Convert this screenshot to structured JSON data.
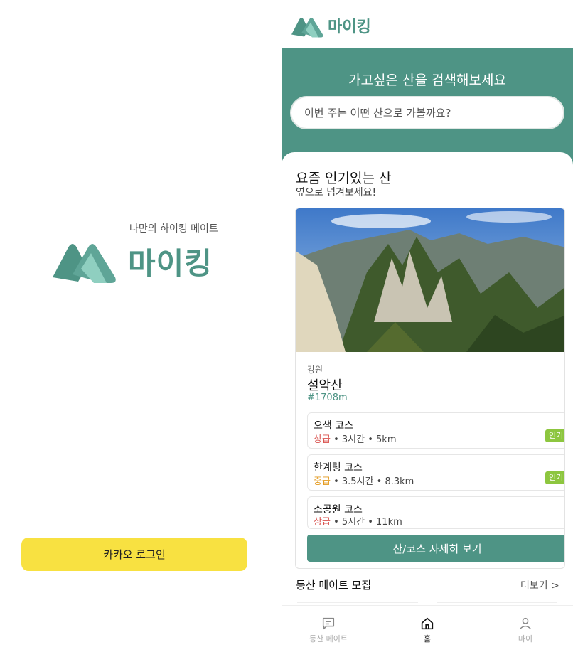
{
  "login": {
    "tagline": "나만의 하이킹 메이트",
    "app_name": "마이킹",
    "kakao_button": "카카오 로그인",
    "kakao_color": "#f8e141"
  },
  "home": {
    "app_name": "마이킹",
    "hero_title": "가고싶은 산을 검색해보세요",
    "search_placeholder": "이번 주는 어떤 산으로 가볼까요?",
    "popular_title": "요즘 인기있는 산",
    "popular_sub": "옆으로 넘겨보세요!",
    "mountain": {
      "region": "강원",
      "name": "설악산",
      "height": "#1708m",
      "courses": [
        {
          "name": "오색 코스",
          "level": "상급",
          "sep1": "•",
          "time": "3시간",
          "sep2": "•",
          "distance": "5km",
          "badge": "인기"
        },
        {
          "name": "한계령 코스",
          "level": "중급",
          "sep1": "•",
          "time": "3.5시간",
          "sep2": "•",
          "distance": "8.3km",
          "badge": "인기"
        },
        {
          "name": "소공원 코스",
          "level": "상급",
          "sep1": "•",
          "time": "5시간",
          "sep2": "•",
          "distance": "11km"
        }
      ]
    },
    "detail_button": "산/코스 자세히 보기",
    "mate_title": "등산 메이트 모집",
    "more_link": "더보기 >",
    "nav": [
      {
        "label": "등산 메이트",
        "icon": "chat-icon"
      },
      {
        "label": "홈",
        "icon": "home-icon"
      },
      {
        "label": "마이",
        "icon": "person-icon"
      }
    ],
    "brand_color": "#4e9485"
  }
}
